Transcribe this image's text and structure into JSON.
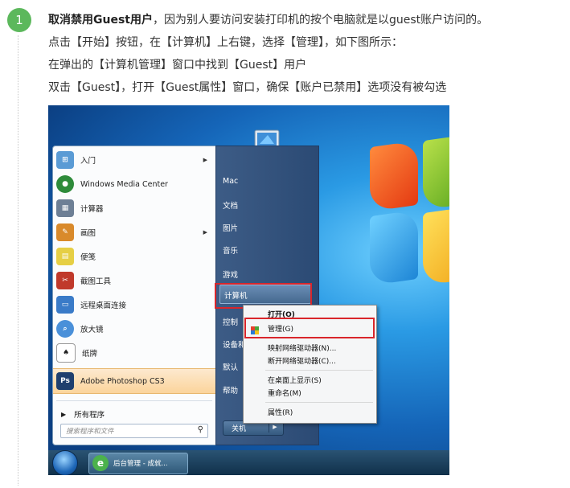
{
  "step": {
    "number": "1",
    "title_bold": "取消禁用Guest用户",
    "title_rest": "，因为别人要访问安装打印机的按个电脑就是以guest账户访问的。",
    "line2": "点击【开始】按钮，在【计算机】上右键，选择【管理】，如下图所示：",
    "line3": "在弹出的【计算机管理】窗口中找到【Guest】用户",
    "line4": "双击【Guest】，打开【Guest属性】窗口，确保【账户已禁用】选项没有被勾选"
  },
  "screenshot": {
    "programs": [
      {
        "label": "入门",
        "icon": "getting-started-icon",
        "color": "#5a9bd5",
        "submenu": true
      },
      {
        "label": "Windows Media Center",
        "icon": "media-center-icon",
        "color": "#2e8b3a",
        "submenu": false
      },
      {
        "label": "计算器",
        "icon": "calculator-icon",
        "color": "#6d7f95",
        "submenu": false
      },
      {
        "label": "画图",
        "icon": "paint-icon",
        "color": "#d98a2b",
        "submenu": true
      },
      {
        "label": "便笺",
        "icon": "sticky-notes-icon",
        "color": "#e6cf45",
        "submenu": false
      },
      {
        "label": "截图工具",
        "icon": "snipping-tool-icon",
        "color": "#c0392b",
        "submenu": false
      },
      {
        "label": "远程桌面连接",
        "icon": "remote-desktop-icon",
        "color": "#3a7bc8",
        "submenu": false
      },
      {
        "label": "放大镜",
        "icon": "magnifier-icon",
        "color": "#4a90d9",
        "submenu": false
      },
      {
        "label": "纸牌",
        "icon": "solitaire-icon",
        "color": "#ffffff",
        "submenu": false
      },
      {
        "label": "Adobe Photoshop CS3",
        "icon": "photoshop-icon",
        "color": "#1f3f6e",
        "submenu": false,
        "highlight": true
      }
    ],
    "all_programs": "所有程序",
    "search_placeholder": "搜索程序和文件",
    "right_items": {
      "user": "Mac",
      "documents": "文档",
      "pictures": "图片",
      "music": "音乐",
      "games": "游戏",
      "computer": "计算机",
      "control_panel": "控制",
      "devices": "设备和",
      "default": "默认",
      "help": "帮助"
    },
    "shutdown": "关机",
    "context_menu": {
      "open": "打开(O)",
      "manage": "管理(G)",
      "map_drive": "映射网络驱动器(N)...",
      "disconnect_drive": "断开网络驱动器(C)...",
      "show_desktop": "在桌面上显示(S)",
      "rename": "重命名(M)",
      "properties": "属性(R)"
    },
    "taskbar_item": "后台管理 - 成就..."
  }
}
